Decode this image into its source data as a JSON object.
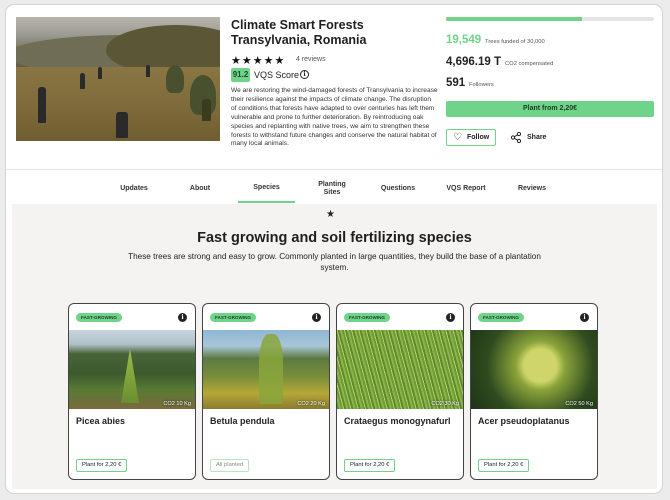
{
  "project": {
    "title": "Climate Smart Forests Transylvania, Romania",
    "stars": "★★★★★",
    "reviews": "4 reviews",
    "vqs_score": "91.2",
    "vqs_label": "VQS Score",
    "description": "We are restoring the wind-damaged forests of Transylvania to increase their resilience against the impacts of climate change. The disruption of conditions that forests have adapted to over centuries has left them vulnerable and prone to further deterioration. By reintroducing oak species and replanting with native trees, we aim to strengthen these forests to withstand future changes and conserve the natural habitat of many local animals."
  },
  "stats": {
    "trees_funded": "19,549",
    "trees_funded_label": "Trees funded of 30,000",
    "progress_fraction": 0.6516,
    "co2": "4,696.19 T",
    "co2_label": "CO2 compensated",
    "followers": "591",
    "followers_label": "Followers"
  },
  "actions": {
    "plant_label": "Plant from 2,20€",
    "follow_label": "Follow",
    "share_label": "Share"
  },
  "tabs": [
    {
      "label": "Updates"
    },
    {
      "label": "About"
    },
    {
      "label": "Species"
    },
    {
      "label": "Planting Sites"
    },
    {
      "label": "Questions"
    },
    {
      "label": "VQS Report"
    },
    {
      "label": "Reviews"
    }
  ],
  "active_tab": "Species",
  "species_section": {
    "title": "Fast growing and soil fertilizing species",
    "subtitle": "These trees are strong and easy to grow. Commonly planted in large quantities, they build the base of a plantation system.",
    "cards": [
      {
        "tag": "FAST-GROWING",
        "co2": "CO2 10 Kg",
        "name": "Picea abies",
        "button": "Plant for 2,20 €",
        "available": true
      },
      {
        "tag": "FAST-GROWING",
        "co2": "CO2 20 Kg",
        "name": "Betula pendula",
        "button": "All planted",
        "available": false
      },
      {
        "tag": "FAST-GROWING",
        "co2": "CO2 30 Kg",
        "name": "Crataegus monogynafurl",
        "button": "Plant for 2,20 €",
        "available": true
      },
      {
        "tag": "FAST-GROWING",
        "co2": "CO2 50 Kg",
        "name": "Acer pseudoplatanus",
        "button": "Plant for 2,20 €",
        "available": true
      }
    ]
  },
  "colors": {
    "accent_green": "#6fd389",
    "text_dark": "#222222",
    "section_bg": "#f5f3f1"
  },
  "icons": {
    "star": "star-icon",
    "info": "info-icon",
    "heart": "heart-icon",
    "share": "share-icon"
  }
}
